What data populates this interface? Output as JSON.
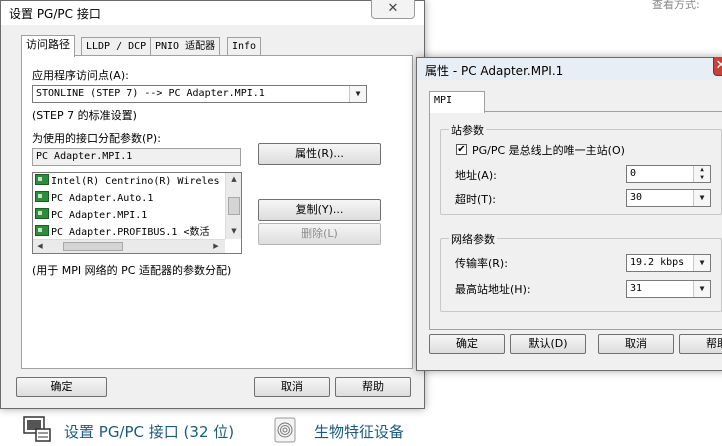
{
  "background": {
    "top_right_fragment": "查看方式:"
  },
  "main_dialog": {
    "title": "设置 PG/PC 接口",
    "tabs": [
      {
        "label": "访问路径"
      },
      {
        "label": "LLDP / DCP"
      },
      {
        "label": "PNIO 适配器"
      },
      {
        "label": "Info"
      }
    ],
    "access_point_label": "应用程序访问点(A):",
    "access_point_value": "STONLINE (STEP 7)        --> PC Adapter.MPI.1",
    "standard_setting": "(STEP 7 的标准设置)",
    "param_label": "为使用的接口分配参数(P):",
    "param_value": "PC Adapter.MPI.1",
    "interfaces": [
      {
        "label": "Intel(R) Centrino(R) Wireles"
      },
      {
        "label": "PC Adapter.Auto.1"
      },
      {
        "label": "PC Adapter.MPI.1"
      },
      {
        "label": "PC Adapter.PROFIBUS.1  <数活"
      }
    ],
    "btn_properties": "属性(R)...",
    "btn_copy": "复制(Y)...",
    "btn_delete": "删除(L)",
    "description": "(用于 MPI 网络的 PC 适配器的参数分配)",
    "btn_ok": "确定",
    "btn_cancel": "取消",
    "btn_help": "帮助"
  },
  "prop_dialog": {
    "title": "属性 - PC Adapter.MPI.1",
    "tab": "MPI",
    "station_group": "站参数",
    "only_master_label": "PG/PC 是总线上的唯一主站(O)",
    "only_master_checked": "✔",
    "address_label": "地址(A):",
    "address_value": "0",
    "timeout_label": "超时(T):",
    "timeout_value": "30",
    "network_group": "网络参数",
    "rate_label": "传输率(R):",
    "rate_value": "19.2 kbps",
    "highest_label": "最高站地址(H):",
    "highest_value": "31",
    "btn_ok": "确定",
    "btn_default": "默认(D)",
    "btn_cancel": "取消",
    "btn_help": "帮助"
  },
  "control_panel": {
    "item1": "设置 PG/PC 接口 (32 位)",
    "item2": "生物特征设备"
  }
}
